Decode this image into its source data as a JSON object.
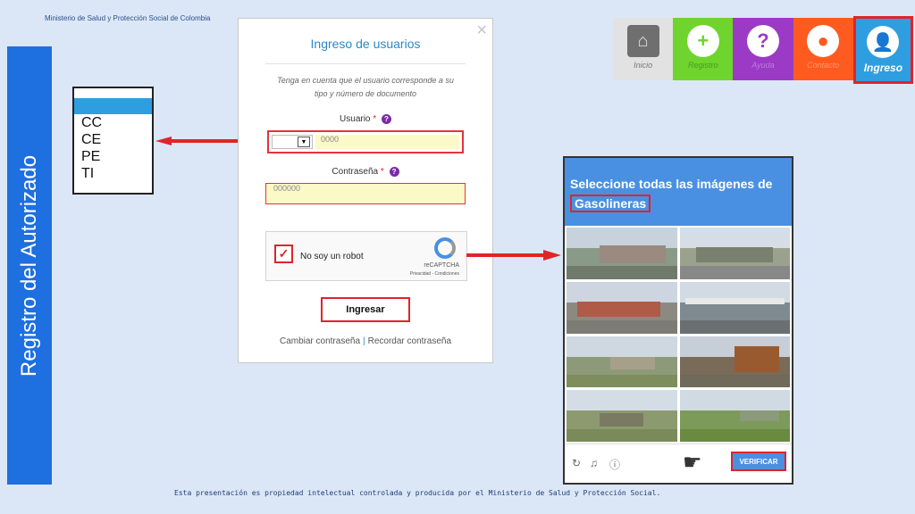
{
  "header": {
    "ministry": "Ministerio de Salud y Protección Social de Colombia"
  },
  "footer": {
    "note": "Esta presentación es propiedad intelectual controlada y producida por el Ministerio de Salud y Protección Social."
  },
  "banner": {
    "text": "Registro del Autorizado"
  },
  "dropdown": {
    "options": [
      "CC",
      "CE",
      "PE",
      "TI"
    ]
  },
  "login": {
    "title": "Ingreso de usuarios",
    "note_line1": "Tenga en cuenta que el usuario corresponde a su",
    "note_line2": "tipo y número de documento",
    "user_label": "Usuario",
    "user_value": "0000",
    "password_label": "Contraseña",
    "password_value": "000000",
    "required_mark": "*",
    "help_icon": "?",
    "close_icon": "×",
    "captcha_label": "No soy un robot",
    "captcha_brand": "reCAPTCHA",
    "captcha_links": "Privacidad - Condiciones",
    "submit_label": "Ingresar",
    "link_change": "Cambiar contraseña",
    "link_separator": "|",
    "link_recover": "Recordar contraseña"
  },
  "nav": {
    "items": [
      {
        "label": "Inicio",
        "icon": "home-icon",
        "color": "#e2e2e2"
      },
      {
        "label": "Registro",
        "icon": "plus-icon",
        "color": "#6fd42e"
      },
      {
        "label": "Ayuda",
        "icon": "question-icon",
        "color": "#9b3ac4"
      },
      {
        "label": "Contacto",
        "icon": "location-pin-icon",
        "color": "#ff5a1f"
      },
      {
        "label": "Ingreso",
        "icon": "user-icon",
        "color": "#2f9ee0"
      }
    ]
  },
  "challenge": {
    "prompt": "Seleccione todas las imágenes de",
    "target": "Gasolineras",
    "verify_label": "VERIFICAR"
  },
  "colors": {
    "accent": "#2a8ac8",
    "highlight": "#e0242a",
    "banner": "#1e6fe0",
    "captcha": "#4a90e2"
  }
}
